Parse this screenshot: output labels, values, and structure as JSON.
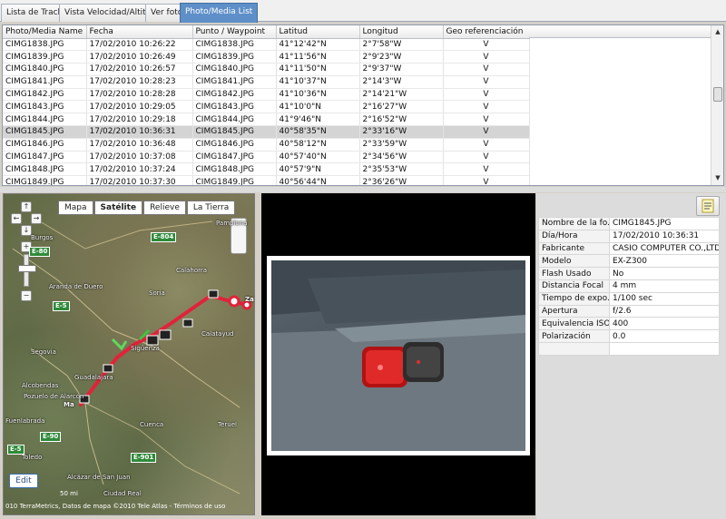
{
  "tabs": [
    {
      "label": "Lista de Tracks",
      "active": false
    },
    {
      "label": "Vista Velocidad/Altitud",
      "active": false
    },
    {
      "label": "Ver foto",
      "active": false
    },
    {
      "label": "Photo/Media List",
      "active": true
    }
  ],
  "table": {
    "columns": [
      "Photo/Media Name",
      "Fecha",
      "Punto / Waypoint",
      "Latitud",
      "Longitud",
      "Geo referenciación"
    ],
    "rows": [
      [
        "CIMG1838.JPG",
        "17/02/2010 10:26:22",
        "CIMG1838.JPG",
        "41°12'42\"N",
        "2°7'58\"W",
        "V"
      ],
      [
        "CIMG1839.JPG",
        "17/02/2010 10:26:49",
        "CIMG1839.JPG",
        "41°11'56\"N",
        "2°9'23\"W",
        "V"
      ],
      [
        "CIMG1840.JPG",
        "17/02/2010 10:26:57",
        "CIMG1840.JPG",
        "41°11'50\"N",
        "2°9'37\"W",
        "V"
      ],
      [
        "CIMG1841.JPG",
        "17/02/2010 10:28:23",
        "CIMG1841.JPG",
        "41°10'37\"N",
        "2°14'3\"W",
        "V"
      ],
      [
        "CIMG1842.JPG",
        "17/02/2010 10:28:28",
        "CIMG1842.JPG",
        "41°10'36\"N",
        "2°14'21\"W",
        "V"
      ],
      [
        "CIMG1843.JPG",
        "17/02/2010 10:29:05",
        "CIMG1843.JPG",
        "41°10'0\"N",
        "2°16'27\"W",
        "V"
      ],
      [
        "CIMG1844.JPG",
        "17/02/2010 10:29:18",
        "CIMG1844.JPG",
        "41°9'46\"N",
        "2°16'52\"W",
        "V"
      ],
      [
        "CIMG1845.JPG",
        "17/02/2010 10:36:31",
        "CIMG1845.JPG",
        "40°58'35\"N",
        "2°33'16\"W",
        "V"
      ],
      [
        "CIMG1846.JPG",
        "17/02/2010 10:36:48",
        "CIMG1846.JPG",
        "40°58'12\"N",
        "2°33'59\"W",
        "V"
      ],
      [
        "CIMG1847.JPG",
        "17/02/2010 10:37:08",
        "CIMG1847.JPG",
        "40°57'40\"N",
        "2°34'56\"W",
        "V"
      ],
      [
        "CIMG1848.JPG",
        "17/02/2010 10:37:24",
        "CIMG1848.JPG",
        "40°57'9\"N",
        "2°35'53\"W",
        "V"
      ],
      [
        "CIMG1849.JPG",
        "17/02/2010 10:37:30",
        "CIMG1849.JPG",
        "40°56'44\"N",
        "2°36'26\"W",
        "V"
      ]
    ],
    "selected_index": 7
  },
  "map": {
    "types": [
      {
        "label": "Mapa",
        "active": false
      },
      {
        "label": "Satélite",
        "active": true
      },
      {
        "label": "Relieve",
        "active": false
      },
      {
        "label": "La Tierra",
        "active": false
      }
    ],
    "labels": [
      {
        "text": "Burgos"
      },
      {
        "text": "Pamplona"
      },
      {
        "text": "Calahorra"
      },
      {
        "text": "Soria"
      },
      {
        "text": "Aranda de Duero"
      },
      {
        "text": "Segovia"
      },
      {
        "text": "Guadalajara"
      },
      {
        "text": "Alcobendas"
      },
      {
        "text": "Pozuelo de Alarcón"
      },
      {
        "text": "Fuenlabrada"
      },
      {
        "text": "Toledo"
      },
      {
        "text": "Cuenca"
      },
      {
        "text": "Teruel"
      },
      {
        "text": "Calatayud"
      },
      {
        "text": "Sigüenza"
      },
      {
        "text": "Alcázar de San Juan"
      },
      {
        "text": "Ciudad Real"
      },
      {
        "text": "Za"
      },
      {
        "text": "Ma"
      }
    ],
    "shields": [
      "E-80",
      "E-804",
      "E-5",
      "E-90",
      "E-901",
      "E-5"
    ],
    "edit_label": "Edit",
    "scale": "50 mi",
    "attribution": "010 TerraMetrics, Datos de mapa ©2010 Tele Atlas - Términos de uso"
  },
  "properties": [
    {
      "key": "Nombre de la fo...",
      "value": "CIMG1845.JPG"
    },
    {
      "key": "Día/Hora",
      "value": "17/02/2010 10:36:31"
    },
    {
      "key": "Fabricante",
      "value": "CASIO COMPUTER CO.,LTD."
    },
    {
      "key": "Modelo",
      "value": "EX-Z300"
    },
    {
      "key": "Flash Usado",
      "value": "No"
    },
    {
      "key": "Distancia Focal",
      "value": "4 mm"
    },
    {
      "key": "Tiempo de expo...",
      "value": "1/100 sec"
    },
    {
      "key": "Apertura",
      "value": "f/2.6"
    },
    {
      "key": "Equivalencia ISO",
      "value": "400"
    },
    {
      "key": "Polarización",
      "value": "0.0"
    },
    {
      "key": "",
      "value": ""
    }
  ],
  "colors": {
    "active_tab": "#5f8fc8",
    "selected_row": "#d4d4d4",
    "track": "#e0233a"
  }
}
